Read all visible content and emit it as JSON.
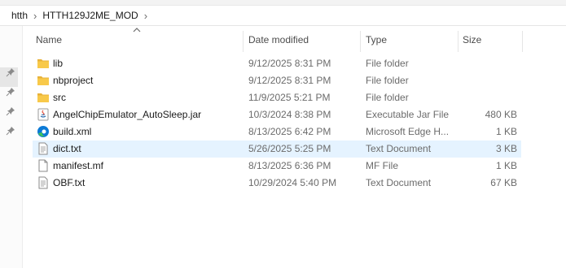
{
  "breadcrumb": {
    "items": [
      "htth",
      "HTTH129J2ME_MOD"
    ]
  },
  "columns": {
    "name": "Name",
    "date": "Date modified",
    "type": "Type",
    "size": "Size"
  },
  "files": [
    {
      "name": "lib",
      "date": "9/12/2025 8:31 PM",
      "type": "File folder",
      "size": "",
      "icon": "folder-icon"
    },
    {
      "name": "nbproject",
      "date": "9/12/2025 8:31 PM",
      "type": "File folder",
      "size": "",
      "icon": "folder-icon"
    },
    {
      "name": "src",
      "date": "11/9/2025 5:21 PM",
      "type": "File folder",
      "size": "",
      "icon": "folder-icon"
    },
    {
      "name": "AngelChipEmulator_AutoSleep.jar",
      "date": "10/3/2024 8:38 PM",
      "type": "Executable Jar File",
      "size": "480 KB",
      "icon": "java-jar-icon"
    },
    {
      "name": "build.xml",
      "date": "8/13/2025 6:42 PM",
      "type": "Microsoft Edge H...",
      "size": "1 KB",
      "icon": "edge-icon"
    },
    {
      "name": "dict.txt",
      "date": "5/26/2025 5:25 PM",
      "type": "Text Document",
      "size": "3 KB",
      "icon": "text-file-icon"
    },
    {
      "name": "manifest.mf",
      "date": "8/13/2025 6:36 PM",
      "type": "MF File",
      "size": "1 KB",
      "icon": "blank-file-icon"
    },
    {
      "name": "OBF.txt",
      "date": "10/29/2024 5:40 PM",
      "type": "Text Document",
      "size": "67 KB",
      "icon": "text-file-icon"
    }
  ],
  "selected_row": "dict.txt",
  "colors": {
    "folder": "#f8c94a",
    "selection": "#e5f3ff",
    "edge_blue": "#0c7ad6",
    "edge_green": "#3ec35a"
  }
}
